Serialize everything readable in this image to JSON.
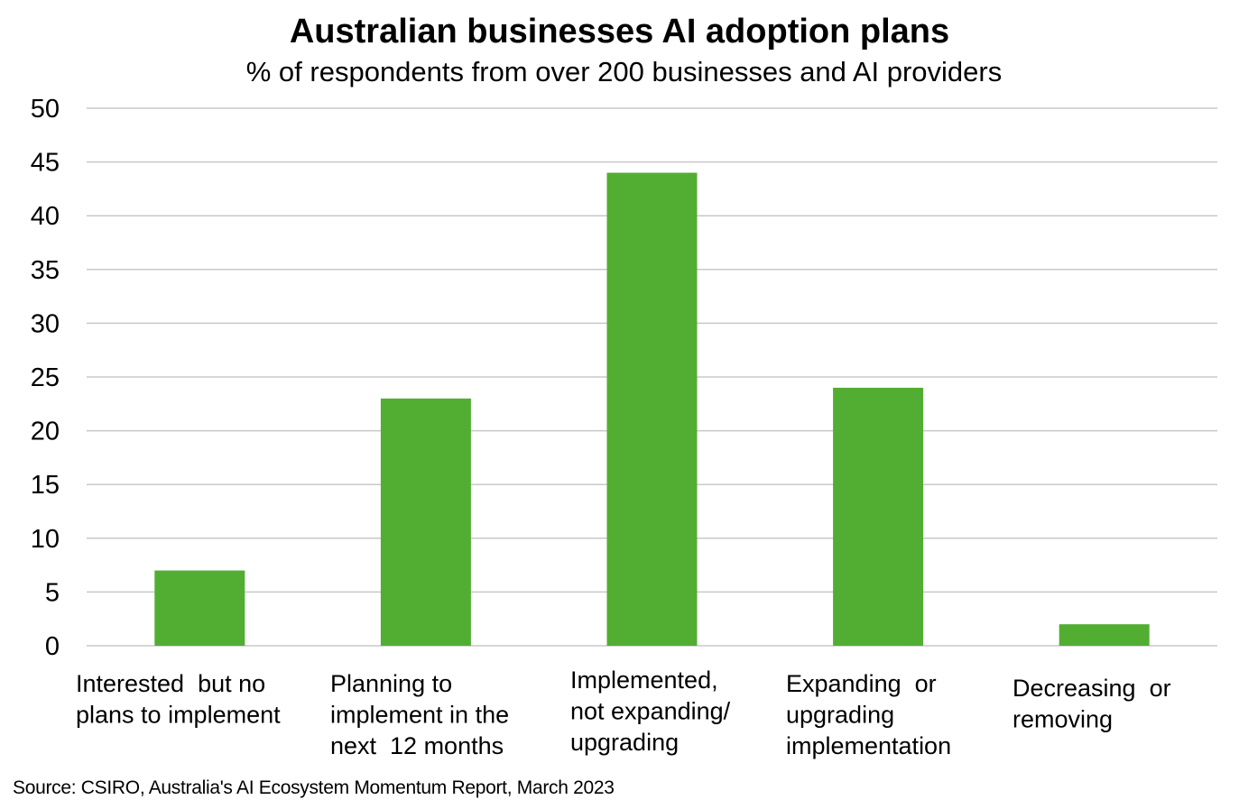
{
  "chart_data": {
    "type": "bar",
    "title": "Australian businesses AI adoption plans",
    "subtitle": "% of respondents from over 200 businesses and AI providers",
    "categories": [
      [
        "Interested  but no",
        "plans to implement"
      ],
      [
        "Planning to",
        "implement in the",
        "next  12 months"
      ],
      [
        "Implemented,",
        "not expanding/",
        "upgrading"
      ],
      [
        "Expanding  or",
        "upgrading",
        "implementation"
      ],
      [
        "Decreasing  or",
        "removing"
      ]
    ],
    "values": [
      7,
      23,
      44,
      24,
      2
    ],
    "xlabel": "",
    "ylabel": "",
    "ylim": [
      0,
      50
    ],
    "yticks": [
      0,
      5,
      10,
      15,
      20,
      25,
      30,
      35,
      40,
      45,
      50
    ],
    "grid": true,
    "legend": "none",
    "bar_color": "#52ae32",
    "grid_color": "#c8c8c8",
    "source": "Source: CSIRO, Australia's AI Ecosystem Momentum Report, March 2023"
  }
}
